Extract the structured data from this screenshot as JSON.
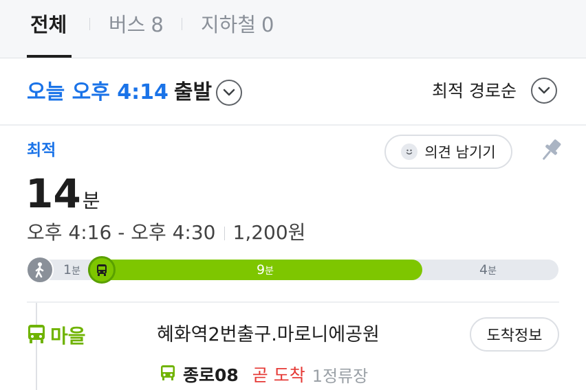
{
  "tabs": [
    {
      "label": "전체",
      "count": ""
    },
    {
      "label": "버스",
      "count": "8"
    },
    {
      "label": "지하철",
      "count": "0"
    }
  ],
  "departure": {
    "time": "오늘 오후 4:14",
    "word": "출발"
  },
  "sort": {
    "label": "최적 경로순"
  },
  "route": {
    "badge": "최적",
    "feedback_label": "의견 남기기",
    "duration_value": "14",
    "duration_unit": "분",
    "time_range": "오후 4:16 - 오후 4:30",
    "fare": "1,200원",
    "segments": [
      {
        "mode": "walk",
        "minutes": "1",
        "unit": "분"
      },
      {
        "mode": "bus",
        "minutes": "9",
        "unit": "분"
      },
      {
        "mode": "walk",
        "minutes": "4",
        "unit": "분"
      }
    ]
  },
  "step": {
    "type_label": "마을",
    "stop_name": "혜화역2번출구.마로니에공원",
    "arrival_info_button": "도착정보",
    "bus_number": "종로08",
    "arrival_status": "곧 도착",
    "stops_away": "1정류장"
  },
  "colors": {
    "accent_blue": "#1a73e8",
    "bus_green": "#7ec600",
    "alert_red": "#e53935"
  },
  "icons": [
    "chevron-down-icon",
    "smile-icon",
    "pin-icon",
    "walk-icon",
    "bus-icon"
  ]
}
